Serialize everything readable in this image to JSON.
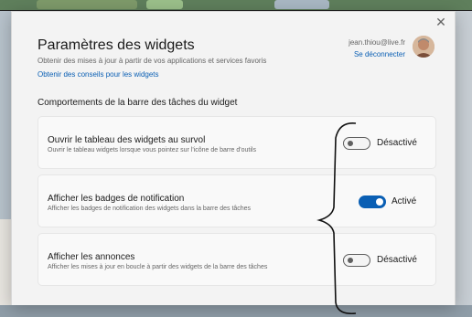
{
  "dialog": {
    "title": "Paramètres des widgets",
    "subtitle": "Obtenir des mises à jour à partir de vos applications et services favoris",
    "tips_link": "Obtenir des conseils pour les widgets",
    "close_glyph": "✕"
  },
  "account": {
    "email": "jean.thiou@live.fr",
    "signout": "Se déconnecter"
  },
  "section": {
    "title": "Comportements de la barre des tâches du widget"
  },
  "settings": [
    {
      "label": "Ouvrir le tableau des widgets au survol",
      "description": "Ouvrir le tableau widgets lorsque vous pointez sur l'icône de barre d'outils",
      "state_label": "Désactivé",
      "on": false
    },
    {
      "label": "Afficher les badges de notification",
      "description": "Afficher les badges de notification des widgets dans la barre des tâches",
      "state_label": "Activé",
      "on": true
    },
    {
      "label": "Afficher les annonces",
      "description": "Afficher les mises à jour en boucle à partir des widgets de la barre des tâches",
      "state_label": "Désactivé",
      "on": false
    }
  ],
  "colors": {
    "accent": "#0a5fb4",
    "dialog_bg": "#f3f3f3",
    "card_bg": "#f9f9f9"
  },
  "icons": {
    "close": "close-icon",
    "avatar": "user-avatar"
  }
}
